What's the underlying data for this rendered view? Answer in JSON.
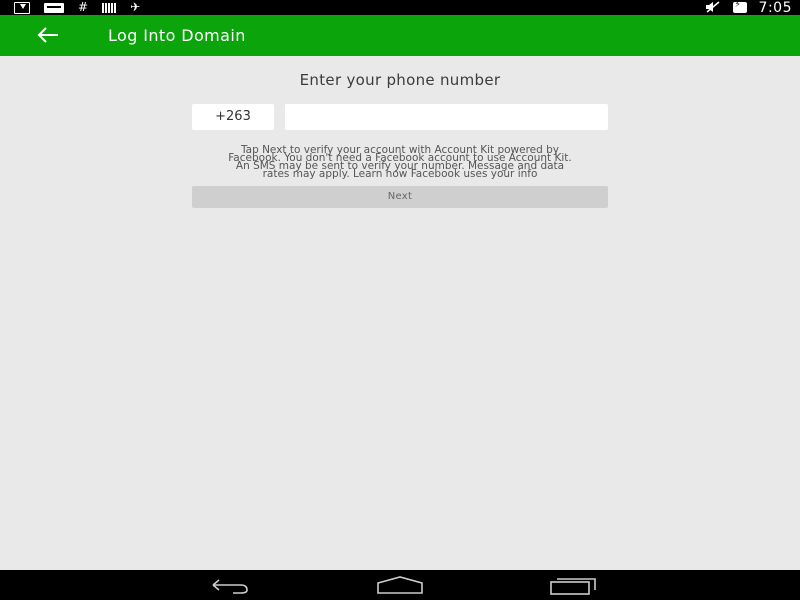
{
  "status_bar": {
    "time": "7:05",
    "left_icons": [
      "download-icon",
      "keyboard-icon",
      "hash-icon",
      "barcode-icon",
      "plane-icon"
    ],
    "right_icons": [
      "mute-icon",
      "battery-charging-icon"
    ],
    "hash_glyph": "#",
    "plane_glyph": "✈"
  },
  "app_bar": {
    "title": "Log Into Domain",
    "color": "#0ba40b"
  },
  "form": {
    "heading": "Enter your phone number",
    "country_code": "+263",
    "phone_value": "",
    "disclaimer_line1": "Tap Next to verify your account with Account Kit powered by",
    "disclaimer_line2": "Facebook. You don't need a Facebook account to use Account Kit.",
    "disclaimer_line3": "An SMS may be sent to verify your number. Message and data",
    "disclaimer_line4": "rates may apply. Learn how Facebook uses your info",
    "next_label": "Next"
  },
  "nav_bar": {
    "buttons": [
      "back-icon",
      "home-icon",
      "recent-apps-icon"
    ]
  }
}
